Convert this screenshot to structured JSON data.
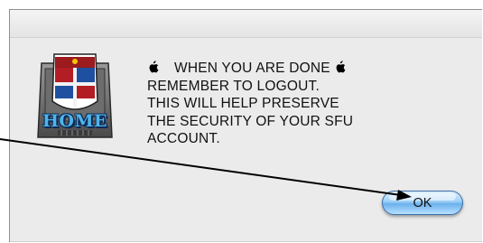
{
  "dialog": {
    "icon": {
      "name": "home-disk-icon",
      "label": "HOME"
    },
    "message": {
      "line1": "WHEN YOU ARE DONE",
      "line2": "REMEMBER TO LOGOUT.",
      "line3": "THIS WILL HELP PRESERVE",
      "line4": "THE SECURITY OF YOUR SFU",
      "line5": "ACCOUNT."
    },
    "ok_button": {
      "label": "OK"
    }
  },
  "annotation": {
    "type": "arrow",
    "points_to": "ok-button"
  },
  "colors": {
    "dialog_bg": "#ebebeb",
    "button_blue": "#6cb1ec",
    "icon_text": "#4fb4ea"
  }
}
